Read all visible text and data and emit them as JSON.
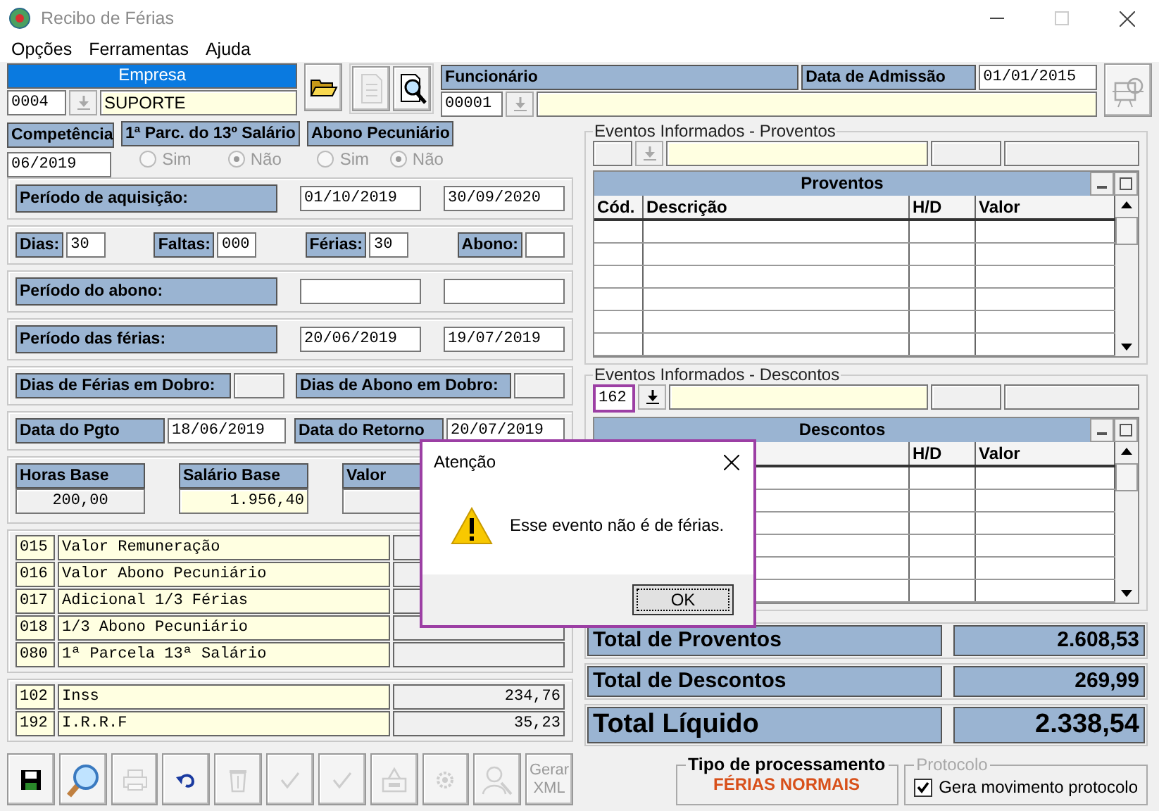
{
  "window": {
    "title": "Recibo de Férias"
  },
  "menu": [
    "Opções",
    "Ferramentas",
    "Ajuda"
  ],
  "empresa": {
    "label": "Empresa",
    "active": true,
    "code": "0004",
    "name": "SUPORTE",
    "lookup_disabled": true
  },
  "top_buttons": [
    {
      "kind": "open",
      "disabled": false
    },
    {
      "kind": "report",
      "disabled": true
    },
    {
      "kind": "find",
      "disabled": false
    }
  ],
  "funcionario": {
    "label": "Funcionário",
    "code": "00001",
    "lookup_disabled": true,
    "admission_label": "Data de Admissão",
    "admission_date": "01/01/2015"
  },
  "side_button": {
    "kind": "tools",
    "disabled": true
  },
  "competencia": {
    "label": "Competência",
    "value": "06/2019"
  },
  "radio_groups": [
    {
      "label": "1ª Parc. do 13º Salário",
      "disabled": true,
      "options": [
        {
          "label": "Sim",
          "selected": false
        },
        {
          "label": "Não",
          "selected": true
        }
      ]
    },
    {
      "label": "Abono Pecuniário",
      "disabled": true,
      "options": [
        {
          "label": "Sim",
          "selected": false
        },
        {
          "label": "Não",
          "selected": true
        }
      ]
    }
  ],
  "panels": [
    {
      "kind": "period",
      "label": "Período de aquisição:",
      "values": [
        "01/10/2019",
        "30/09/2020"
      ]
    },
    {
      "kind": "days",
      "items": [
        {
          "label": "Dias:",
          "value": "30"
        },
        {
          "label": "Faltas:",
          "value": "000"
        },
        {
          "label": "Férias:",
          "value": "30"
        },
        {
          "label": "Abono:"
        }
      ]
    },
    {
      "kind": "period",
      "label": "Período do abono:"
    },
    {
      "kind": "period",
      "label": "Período das férias:",
      "values": [
        "20/06/2019",
        "19/07/2019"
      ]
    },
    {
      "kind": "pairs",
      "items": [
        {
          "label": "Dias de Férias em Dobro:"
        },
        {
          "label": "Dias de Abono em Dobro:"
        }
      ]
    },
    {
      "kind": "dates",
      "items": [
        {
          "label": "Data do Pgto",
          "value": "18/06/2019"
        },
        {
          "label": "Data do Retorno",
          "value": "20/07/2019"
        }
      ]
    },
    {
      "kind": "bases",
      "items": [
        {
          "label": "Horas Base",
          "value": "200,00",
          "editable": false
        },
        {
          "label": "Salário Base",
          "value": "1.956,40",
          "editable": true
        },
        {
          "label": "Valor"
        }
      ]
    },
    {
      "kind": "events",
      "rows": [
        {
          "code": "015",
          "description": "Valor Remuneração"
        },
        {
          "code": "016",
          "description": "Valor Abono Pecuniário"
        },
        {
          "code": "017",
          "description": "Adicional 1/3 Férias"
        },
        {
          "code": "018",
          "description": "1/3 Abono Pecuniário"
        },
        {
          "code": "080",
          "description": "1ª Parcela 13ª Salário"
        }
      ]
    },
    {
      "kind": "events",
      "rows": [
        {
          "code": "102",
          "description": "Inss",
          "value": "234,76"
        },
        {
          "code": "192",
          "description": "I.R.R.F",
          "value": "35,23"
        }
      ]
    }
  ],
  "toolbar": [
    {
      "kind": "save",
      "disabled": false
    },
    {
      "kind": "search",
      "disabled": false
    },
    {
      "kind": "print",
      "disabled": true
    },
    {
      "kind": "undo",
      "disabled": false
    },
    {
      "kind": "recycle",
      "disabled": true
    },
    {
      "kind": "check",
      "disabled": true
    },
    {
      "kind": "check",
      "disabled": true
    },
    {
      "kind": "export",
      "disabled": true
    },
    {
      "kind": "gear",
      "disabled": true
    },
    {
      "kind": "person",
      "disabled": true
    },
    {
      "kind": "text",
      "label": "Gerar XML",
      "disabled": true
    }
  ],
  "proventos": {
    "legend": "Eventos Informados - Proventos",
    "lookup_disabled": true,
    "title": "Proventos",
    "columns": [
      "Cód.",
      "Descrição",
      "H/D",
      "Valor"
    ]
  },
  "descontos": {
    "legend": "Eventos Informados - Descontos",
    "code": "162",
    "lookup_disabled": false,
    "title": "Descontos",
    "columns": [
      "H/D",
      "Valor"
    ]
  },
  "totals": [
    {
      "kind": "subtotal",
      "label": "Total de Proventos",
      "value": "2.608,53"
    },
    {
      "kind": "subtotal",
      "label": "Total de Descontos",
      "value": "269,99"
    },
    {
      "kind": "net",
      "label": "Total Líquido",
      "value": "2.338,54"
    }
  ],
  "processing": {
    "label": "Tipo de processamento",
    "value": "FÉRIAS NORMAIS"
  },
  "protocol": {
    "legend": "Protocolo",
    "disabled": true,
    "checkbox": {
      "label": "Gera movimento protocolo",
      "checked": true
    }
  },
  "dialog": {
    "title": "Atenção",
    "message": "Esse evento não é de férias.",
    "button": "OK"
  }
}
